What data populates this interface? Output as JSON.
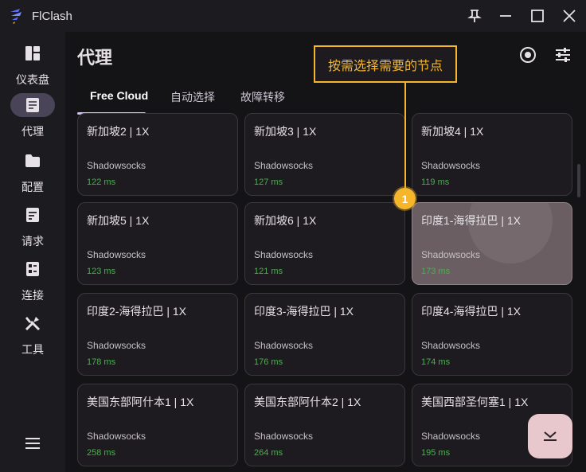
{
  "app": {
    "title": "FlClash",
    "colors": {
      "accent": "#d0bcff",
      "delay_ok": "#4caf50",
      "annotation": "#f5b62b",
      "selected_card": "#6b5e62",
      "fab": "#e8c8cc"
    }
  },
  "window_controls": [
    "pin-icon",
    "minimize-icon",
    "maximize-icon",
    "close-icon"
  ],
  "sidebar": {
    "items": [
      {
        "label": "仪表盘",
        "icon": "dashboard-icon",
        "active": false
      },
      {
        "label": "代理",
        "icon": "proxy-icon",
        "active": true
      },
      {
        "label": "配置",
        "icon": "folder-icon",
        "active": false
      },
      {
        "label": "请求",
        "icon": "request-icon",
        "active": false
      },
      {
        "label": "连接",
        "icon": "connection-icon",
        "active": false
      },
      {
        "label": "工具",
        "icon": "tools-icon",
        "active": false
      }
    ],
    "menu_icon": "menu-icon"
  },
  "header": {
    "title": "代理",
    "actions": [
      "target-icon",
      "tune-icon"
    ]
  },
  "tabs": [
    {
      "label": "Free Cloud",
      "active": true
    },
    {
      "label": "自动选择",
      "active": false
    },
    {
      "label": "故障转移",
      "active": false
    }
  ],
  "proxies": [
    {
      "name": "新加坡2 | 1X",
      "type": "Shadowsocks",
      "delay": "122 ms"
    },
    {
      "name": "新加坡3 | 1X",
      "type": "Shadowsocks",
      "delay": "127 ms"
    },
    {
      "name": "新加坡4 | 1X",
      "type": "Shadowsocks",
      "delay": "119 ms"
    },
    {
      "name": "新加坡5 | 1X",
      "type": "Shadowsocks",
      "delay": "123 ms"
    },
    {
      "name": "新加坡6 | 1X",
      "type": "Shadowsocks",
      "delay": "121 ms"
    },
    {
      "name": "印度1-海得拉巴 | 1X",
      "type": "Shadowsocks",
      "delay": "173 ms",
      "selected": true
    },
    {
      "name": "印度2-海得拉巴 | 1X",
      "type": "Shadowsocks",
      "delay": "178 ms"
    },
    {
      "name": "印度3-海得拉巴 | 1X",
      "type": "Shadowsocks",
      "delay": "176 ms"
    },
    {
      "name": "印度4-海得拉巴 | 1X",
      "type": "Shadowsocks",
      "delay": "174 ms"
    },
    {
      "name": "美国东部阿什本1 | 1X",
      "type": "Shadowsocks",
      "delay": "258 ms"
    },
    {
      "name": "美国东部阿什本2 | 1X",
      "type": "Shadowsocks",
      "delay": "264 ms"
    },
    {
      "name": "美国西部圣何塞1 | 1X",
      "type": "Shadowsocks",
      "delay": "195 ms"
    }
  ],
  "fab": {
    "icon": "collapse-icon"
  },
  "annotation": {
    "text": "按需选择需要的节点",
    "badge": "1"
  }
}
